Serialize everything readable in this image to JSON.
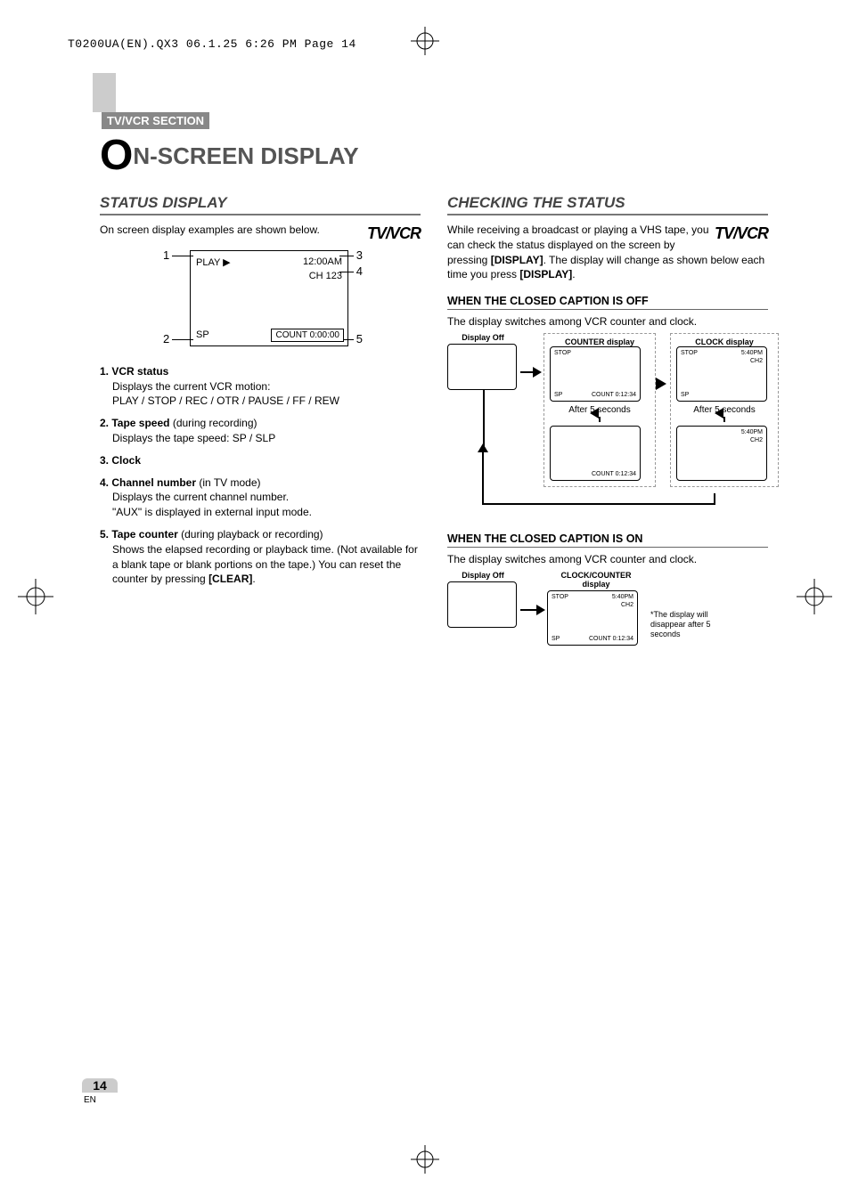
{
  "print_header": "T0200UA(EN).QX3  06.1.25  6:26 PM  Page 14",
  "section_label": "TV/VCR SECTION",
  "title_big_letter": "O",
  "title_rest": "N-SCREEN DISPLAY",
  "tvvcr_logo_text": "TV/VCR",
  "left": {
    "heading": "STATUS DISPLAY",
    "intro": "On screen display examples are shown below.",
    "osd": {
      "play": "PLAY ▶",
      "time": "12:00AM",
      "ch": "CH 123",
      "sp": "SP",
      "count": "COUNT   0:00:00"
    },
    "callouts": {
      "n1": "1",
      "n2": "2",
      "n3": "3",
      "n4": "4",
      "n5": "5"
    },
    "items": [
      {
        "lead": "1. VCR status",
        "body": "Displays the current VCR motion:\nPLAY / STOP / REC / OTR / PAUSE / FF / REW"
      },
      {
        "lead": "2. Tape speed",
        "paren": " (during recording)",
        "body": "Displays the tape speed: SP / SLP"
      },
      {
        "lead": "3. Clock",
        "body": ""
      },
      {
        "lead": "4. Channel number",
        "paren": " (in TV mode)",
        "body": "Displays the current channel number.\n\"AUX\" is displayed in external input mode."
      },
      {
        "lead": "5. Tape counter",
        "paren": " (during playback or recording)",
        "body": "Shows the elapsed recording or playback time. (Not available for a blank tape or blank portions on the tape.) You can reset the counter by pressing ",
        "bold_end": "[CLEAR]",
        "tail": "."
      }
    ]
  },
  "right": {
    "heading": "CHECKING THE STATUS",
    "para1_a": "While receiving a broadcast or playing a VHS tape, you can check the status displayed on the screen by pressing ",
    "para1_b": "[DISPLAY]",
    "para1_c": ". The display will change as shown below each time you press ",
    "para1_d": "[DISPLAY]",
    "para1_e": ".",
    "sub1": "WHEN THE CLOSED CAPTION IS OFF",
    "sub1_line": "The display switches among VCR counter and clock.",
    "labels": {
      "display_off": "Display Off",
      "counter_display": "COUNTER display",
      "clock_display": "CLOCK display",
      "clockcounter_display": "CLOCK/COUNTER display"
    },
    "mini": {
      "stop": "STOP",
      "sp": "SP",
      "count": "COUNT  0:12:34",
      "time": "5:40PM",
      "ch": "CH2"
    },
    "after5": "After 5 seconds",
    "sub2": "WHEN THE CLOSED CAPTION IS ON",
    "sub2_line": "The display switches among VCR counter and clock.",
    "note": "*The display will disappear after 5 seconds"
  },
  "page_number": "14",
  "page_lang": "EN"
}
